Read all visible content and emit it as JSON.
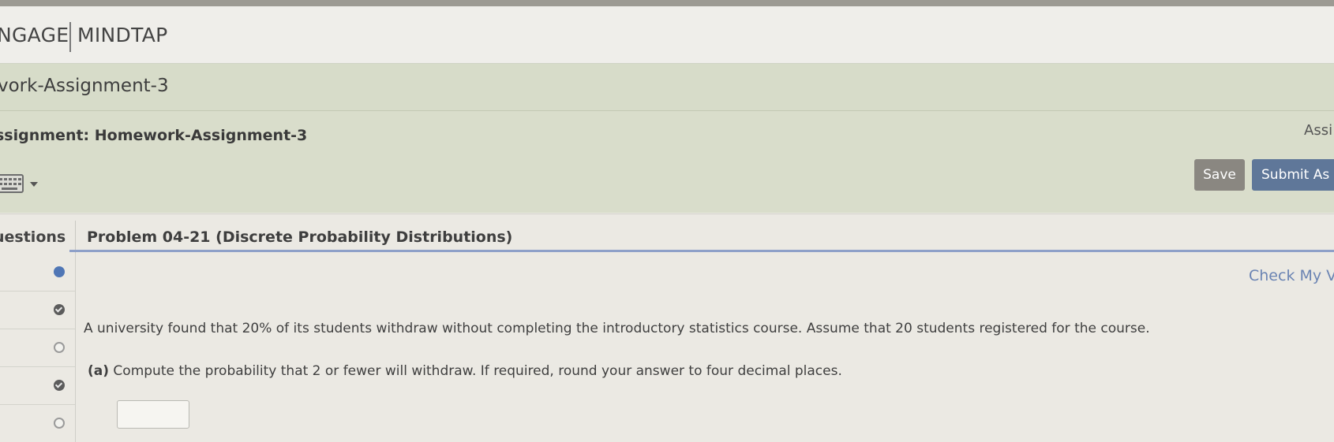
{
  "brand": {
    "left": "NGAGE",
    "right": "MINDTAP"
  },
  "breadcrumb": "vork-Assignment-3",
  "assignment": {
    "title": "ssignment: Homework-Assignment-3",
    "right_label": "Assi",
    "keyboard_icon": "keyboard-icon"
  },
  "toolbar": {
    "save_label": "Save",
    "submit_label": "Submit As"
  },
  "tabs": {
    "questions_label": "uestions",
    "problem_title": "Problem 04-21 (Discrete Probability Distributions)"
  },
  "question_list": [
    {
      "status": "current"
    },
    {
      "status": "answered"
    },
    {
      "status": "unanswered"
    },
    {
      "status": "answered"
    },
    {
      "status": "unanswered"
    }
  ],
  "problem": {
    "check_label": "Check My V",
    "statement": "A university found that 20% of its students withdraw without completing the introductory statistics course. Assume that 20 students registered for the course.",
    "part_a_label": "(a)",
    "part_a_text": "Compute the probability that 2 or fewer will withdraw. If required, round your answer to four decimal places.",
    "answer_value": ""
  },
  "colors": {
    "accent_blue": "#5f7799",
    "save_gray": "#8a8781",
    "header_green": "#d9ddcb",
    "link_blue": "#6b84b3"
  }
}
